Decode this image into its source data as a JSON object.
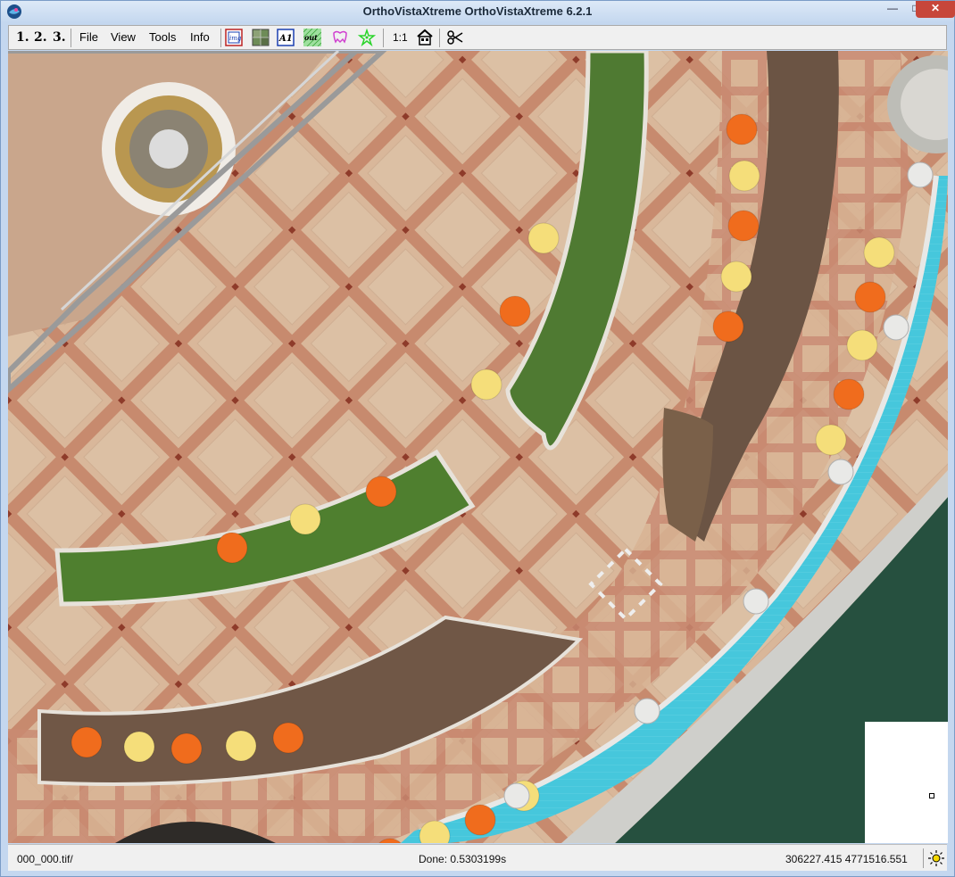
{
  "window": {
    "title": "OrthoVistaXtreme OrthoVistaXtreme 6.2.1",
    "minimize_glyph": "—",
    "maximize_glyph": "□",
    "close_glyph": "✕"
  },
  "toolbar": {
    "steps": [
      "1.",
      "2.",
      "3."
    ],
    "menus": [
      "File",
      "View",
      "Tools",
      "Info"
    ],
    "icon_img_label": "img",
    "icon_a1_label": "A1",
    "icon_out_label": "out",
    "zoom_label": "1:1",
    "icons": [
      "image-frame-icon",
      "mosaic-icon",
      "a1-icon",
      "out-icon",
      "tooth-icon",
      "star-outline-icon",
      "home-icon",
      "scissors-icon"
    ]
  },
  "status": {
    "file": "000_000.tif/",
    "done": "Done: 0.5303199s",
    "coords": "306227.415 4771516.551"
  },
  "colors": {
    "title_bg": "#c4d7ef",
    "close_button": "#c7463a",
    "pool": "#46c7dc",
    "water": "#28503f",
    "pavement": "#d5b096",
    "umbrella_orange": "#f06c1d",
    "umbrella_yellow": "#f5de7a"
  }
}
